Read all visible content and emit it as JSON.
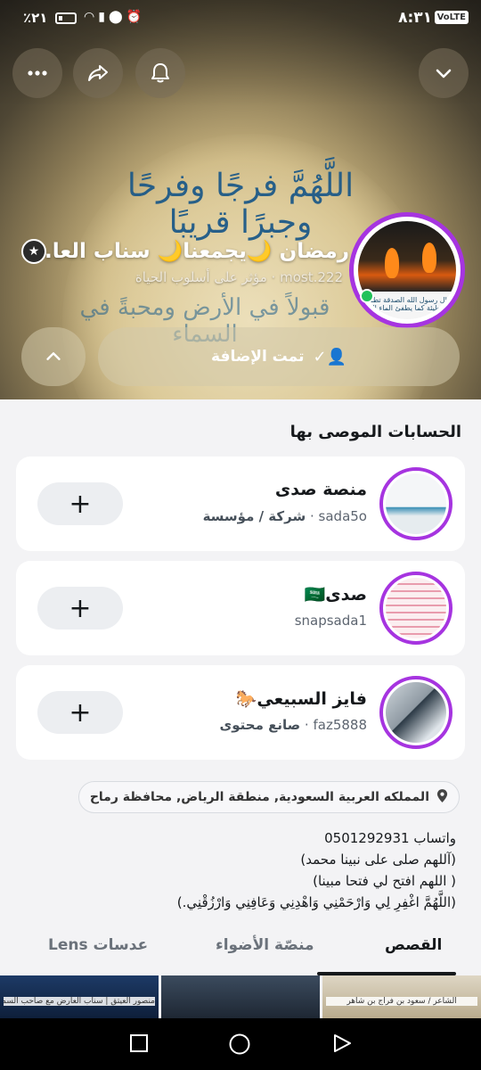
{
  "status_bar": {
    "time": "٨:٣١",
    "network_badge": "VoLTE",
    "battery_percent": "٪٢١",
    "icons": [
      "wifi-icon",
      "signal-icon",
      "location-icon",
      "alarm-icon",
      "lte-icon"
    ]
  },
  "header": {
    "background_text": "اللَّهُمَّ فرجًا وفرحًا وجبرًا قريبًا",
    "background_text_2": "قبولاً في الأرض ومحبةً في السماء",
    "profile_name": "رمضان 🌙يجمعنا🌙 سناب العا...",
    "username": "most.222",
    "category": "مؤثر على أسلوب الحياة",
    "separator": "·",
    "avatar_caption": "قال رسول الله الصدقة تطفئ الخطيئة كما يطفئ الماء النار",
    "added_button_label": "تمت الإضافة",
    "buttons": [
      "chevron-down-icon",
      "bell-icon",
      "share-icon",
      "more-icon"
    ]
  },
  "recommended": {
    "title": "الحسابات الموصى بها",
    "accounts": [
      {
        "name": "منصة صدى",
        "username": "sada5o",
        "category": "شركة / مؤسسة",
        "add_label": "+"
      },
      {
        "name": "صدى🇸🇦",
        "username": "snapsada1",
        "category": "",
        "add_label": "+"
      },
      {
        "name": "فايز السبيعي🐎",
        "username": "faz5888",
        "category": "صانع محتوى",
        "add_label": "+"
      }
    ]
  },
  "location": "المملكه العربية السعودية, منطقة الرياض, محافظة رماح",
  "bio": {
    "line1": "واتساب 0501292931",
    "line2": "(آللهم صلى على نبينا محمد)",
    "line3": "( اللهم افتح لي فتحا مبينا)",
    "line4": "(اللَّهُمَّ اغْفِرِ لِي وَارْحَمْنِي وَاهْدِنِي وَعَافِنِي وَارْزُقْنِي.)"
  },
  "tabs": {
    "stories": "القصص",
    "spotlight": "منصّة الأضواء",
    "lenses": "عدسات Lens"
  },
  "story_thumbs": [
    {
      "label": "الشاعر / سعود بن فراج بن شاهر"
    },
    {
      "label": ""
    },
    {
      "label": "منصور العيتق | سناب العارض مع صاحب السمو الملكي الامير / فيصل بن خالد بن ناصر"
    }
  ],
  "colors": {
    "story_ring": "#a634e0",
    "online": "#21c25a"
  }
}
